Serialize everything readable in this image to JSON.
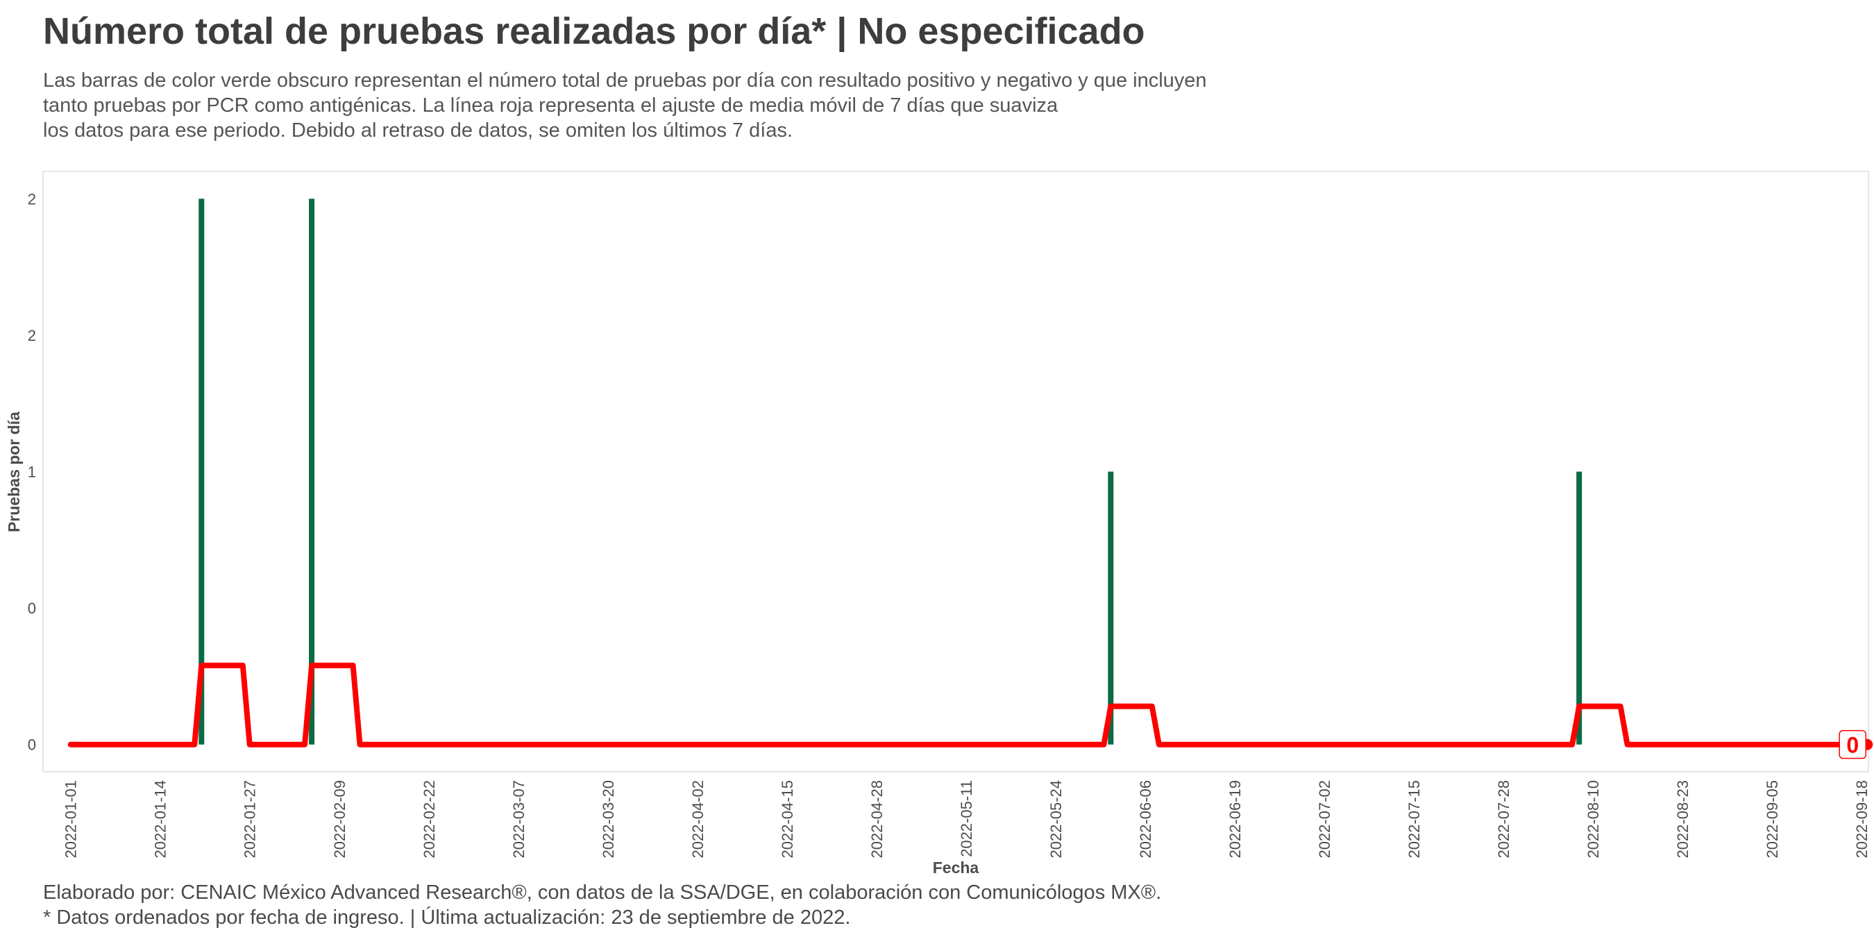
{
  "header": {
    "title": "Número total de pruebas realizadas por día* | No especificado",
    "subtitle": "Las barras de color verde obscuro representan el número total de pruebas por día con resultado positivo y negativo y que incluyen\ntanto pruebas por PCR como antigénicas. La línea roja representa el ajuste de media móvil de 7 días que suaviza\nlos datos para ese periodo. Debido al retraso de datos, se omiten los últimos 7 días."
  },
  "footer": {
    "caption": "Elaborado por: CENAIC México Advanced Research®, con datos de la SSA/DGE, en colaboración con Comunicólogos MX®.\n* Datos ordenados por fecha de ingreso. | Última actualización: 23 de septiembre de 2022."
  },
  "colors": {
    "bars": "#0b6b45",
    "line": "#ff0000",
    "panel_border": "#e6e6e6",
    "axis_text": "#4d4d4d"
  },
  "chart_data": {
    "type": "bar",
    "title": "Número total de pruebas realizadas por día* | No especificado",
    "xlabel": "Fecha",
    "ylabel": "Pruebas por día",
    "x_range": [
      "2022-01-01",
      "2022-09-16"
    ],
    "xlim": [
      "2021-12-28",
      "2022-09-19"
    ],
    "ylim": [
      -0.1,
      2.1
    ],
    "yticks": [
      0,
      0.5,
      1,
      1.5,
      2
    ],
    "ytick_labels": [
      "0",
      "0",
      "1",
      "2",
      "2"
    ],
    "xticks": [
      "2022-01-01",
      "2022-01-14",
      "2022-01-27",
      "2022-02-09",
      "2022-02-22",
      "2022-03-07",
      "2022-03-20",
      "2022-04-02",
      "2022-04-15",
      "2022-04-28",
      "2022-05-11",
      "2022-05-24",
      "2022-06-06",
      "2022-06-19",
      "2022-07-02",
      "2022-07-15",
      "2022-07-28",
      "2022-08-10",
      "2022-08-23",
      "2022-09-05",
      "2022-09-18"
    ],
    "grid": false,
    "series": [
      {
        "kind": "bar",
        "points": [
          {
            "x": "2022-01-20",
            "y": 2
          },
          {
            "x": "2022-02-05",
            "y": 2
          },
          {
            "x": "2022-06-01",
            "y": 1
          },
          {
            "x": "2022-08-08",
            "y": 1
          }
        ]
      },
      {
        "kind": "line",
        "points": [
          {
            "x": "2022-01-01",
            "y": 0
          },
          {
            "x": "2022-01-19",
            "y": 0
          },
          {
            "x": "2022-01-20",
            "y": 0.29
          },
          {
            "x": "2022-01-26",
            "y": 0.29
          },
          {
            "x": "2022-01-27",
            "y": 0
          },
          {
            "x": "2022-02-04",
            "y": 0
          },
          {
            "x": "2022-02-05",
            "y": 0.29
          },
          {
            "x": "2022-02-11",
            "y": 0.29
          },
          {
            "x": "2022-02-12",
            "y": 0
          },
          {
            "x": "2022-05-31",
            "y": 0
          },
          {
            "x": "2022-06-01",
            "y": 0.14
          },
          {
            "x": "2022-06-07",
            "y": 0.14
          },
          {
            "x": "2022-06-08",
            "y": 0
          },
          {
            "x": "2022-08-07",
            "y": 0
          },
          {
            "x": "2022-08-08",
            "y": 0.14
          },
          {
            "x": "2022-08-14",
            "y": 0.14
          },
          {
            "x": "2022-08-15",
            "y": 0
          },
          {
            "x": "2022-09-16",
            "y": 0
          }
        ]
      }
    ],
    "end_label": {
      "x": "2022-09-16",
      "y": 0,
      "text": "0"
    }
  }
}
